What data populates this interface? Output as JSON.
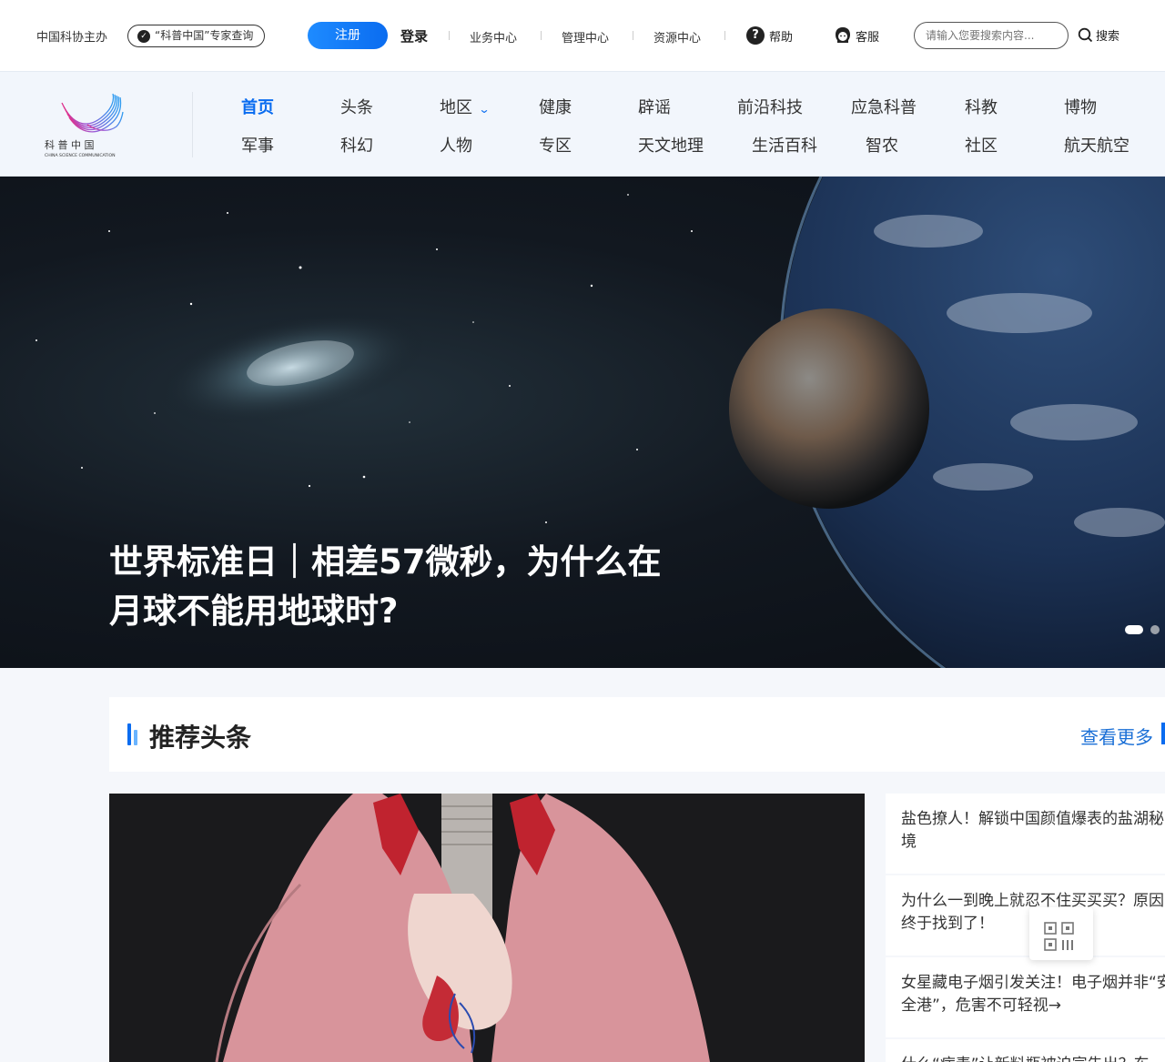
{
  "topbar": {
    "org_text": "中国科协主办",
    "expert_query": "“科普中国”专家查询",
    "register": "注册",
    "login": "登录",
    "links": [
      "业务中心",
      "管理中心",
      "资源中心"
    ],
    "help": "帮助",
    "service": "客服",
    "search_placeholder": "请输入您要搜索内容...",
    "search_button": "搜索"
  },
  "logo": {
    "cn": "科 普 中 国",
    "en": "CHINA SCIENCE COMMUNICATION"
  },
  "nav": {
    "row1": [
      "首页",
      "头条",
      "地区",
      "健康",
      "辟谣",
      "前沿科技",
      "应急科普",
      "科教",
      "博物"
    ],
    "row2": [
      "军事",
      "科幻",
      "人物",
      "专区",
      "天文地理",
      "生活百科",
      "智农",
      "社区",
      "航天航空"
    ],
    "active": "首页"
  },
  "hero": {
    "title_line1": "世界标准日｜相差57微秒，为什么在",
    "title_line2": "月球不能用地球时?"
  },
  "section": {
    "title": "推荐头条",
    "more": "查看更多"
  },
  "news": [
    "盐色撩人！解锁中国颜值爆表的盐湖秘境",
    "为什么一到晚上就忍不住买买买？原因终于找到了！",
    "女星藏电子烟引发关注！电子烟并非“安全港”，危害不可轻视→",
    "什么“病毒”让新料瓶被迫宣告出？东"
  ],
  "colors": {
    "brand_blue": "#0a6cf0",
    "nav_bg": "#f2f6fc"
  }
}
